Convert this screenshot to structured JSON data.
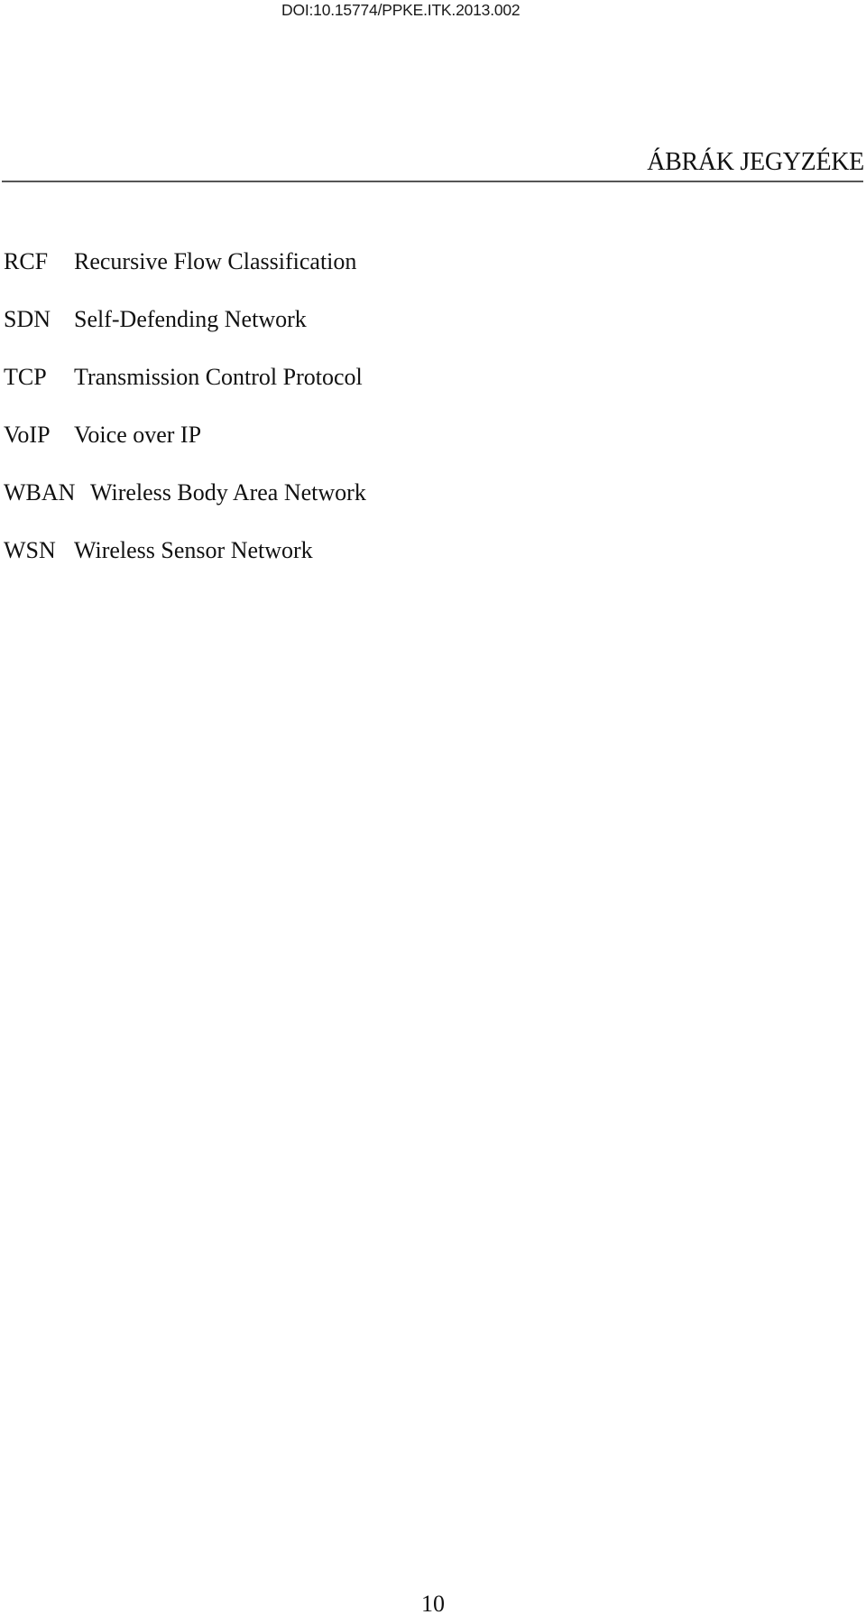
{
  "header": {
    "doi": "DOI:10.15774/PPKE.ITK.2013.002",
    "chapter_title": "ÁBRÁK JEGYZÉKE"
  },
  "abbreviations": [
    {
      "abbr": "RCF",
      "definition": "Recursive Flow Classification"
    },
    {
      "abbr": "SDN",
      "definition": "Self-Defending Network"
    },
    {
      "abbr": "TCP",
      "definition": "Transmission Control Protocol"
    },
    {
      "abbr": "VoIP",
      "definition": "Voice over IP"
    },
    {
      "abbr": "WBAN",
      "definition": "Wireless Body Area Network"
    },
    {
      "abbr": "WSN",
      "definition": "Wireless Sensor Network"
    }
  ],
  "footer": {
    "page_number": "10"
  }
}
